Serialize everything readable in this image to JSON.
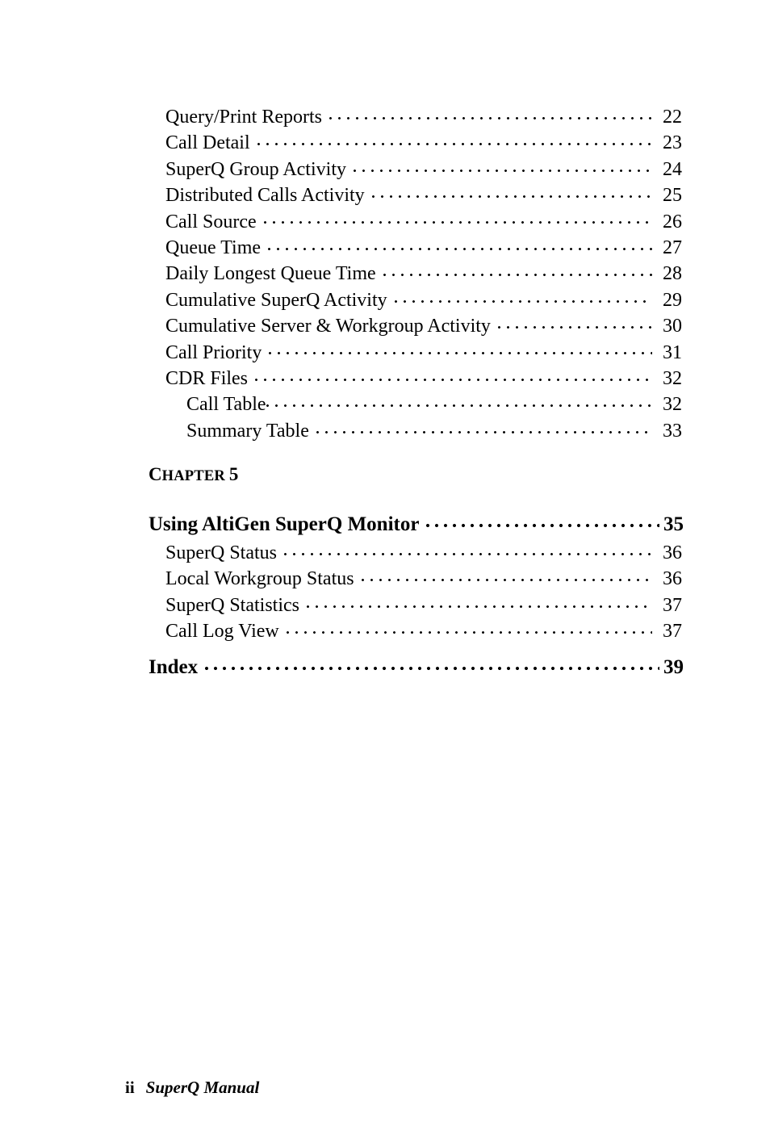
{
  "document": {
    "type": "table-of-contents",
    "page_background": "#ffffff",
    "text_color": "#000000"
  },
  "toc": {
    "entries": [
      {
        "label": "Query/Print Reports",
        "page": "22",
        "level": 1
      },
      {
        "label": "Call Detail",
        "page": "23",
        "level": 1
      },
      {
        "label": "SuperQ Group Activity",
        "page": "24",
        "level": 1
      },
      {
        "label": "Distributed Calls Activity",
        "page": "25",
        "level": 1
      },
      {
        "label": "Call Source",
        "page": "26",
        "level": 1
      },
      {
        "label": "Queue Time",
        "page": "27",
        "level": 1
      },
      {
        "label": "Daily Longest Queue Time",
        "page": "28",
        "level": 1
      },
      {
        "label": "Cumulative SuperQ Activity",
        "page": "29",
        "level": 1
      },
      {
        "label": "Cumulative Server & Workgroup Activity",
        "page": "30",
        "level": 1
      },
      {
        "label": "Call Priority",
        "page": "31",
        "level": 1
      },
      {
        "label": "CDR Files",
        "page": "32",
        "level": 1
      },
      {
        "label": "Call Table",
        "page": "32",
        "level": 2,
        "tight": true
      },
      {
        "label": "Summary Table",
        "page": "33",
        "level": 2
      }
    ]
  },
  "chapter": {
    "label_first_letter": "C",
    "label_rest": "HAPTER",
    "number": "5",
    "title": "Using AltiGen SuperQ Monitor",
    "title_page": "35",
    "entries": [
      {
        "label": "SuperQ Status",
        "page": "36",
        "level": 1
      },
      {
        "label": "Local Workgroup Status",
        "page": "36",
        "level": 1
      },
      {
        "label": "SuperQ Statistics",
        "page": "37",
        "level": 1
      },
      {
        "label": "Call Log View",
        "page": "37",
        "level": 1
      }
    ]
  },
  "index": {
    "label": "Index",
    "page": "39"
  },
  "footer": {
    "folio": "ii",
    "manual_title": "SuperQ Manual"
  }
}
